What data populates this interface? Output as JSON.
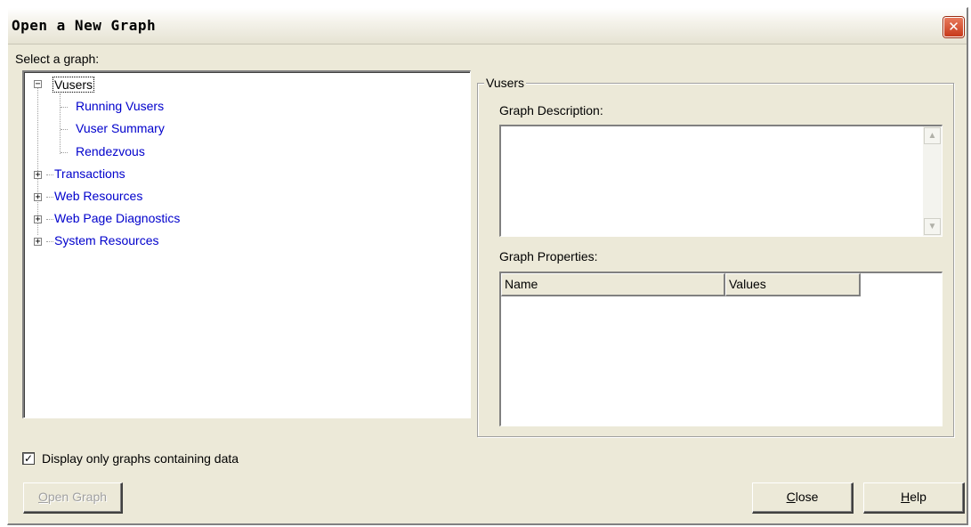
{
  "dialog": {
    "title": "Open a New Graph",
    "close_glyph": "✕"
  },
  "tree": {
    "label": "Select a graph:",
    "root": {
      "label": "Vusers",
      "expander": "−",
      "children": [
        "Running Vusers",
        "Vuser Summary",
        "Rendezvous"
      ]
    },
    "collapsed": [
      {
        "label": "Transactions",
        "expander": "+"
      },
      {
        "label": "Web Resources",
        "expander": "+"
      },
      {
        "label": "Web Page Diagnostics",
        "expander": "+"
      },
      {
        "label": "System Resources",
        "expander": "+"
      }
    ]
  },
  "details": {
    "group_title": "Vusers",
    "description_label": "Graph Description:",
    "description_value": "",
    "properties_label": "Graph Properties:",
    "columns": [
      "Name",
      "Values"
    ]
  },
  "options": {
    "display_only_data_label": "Display only graphs containing data",
    "display_only_data_checked": true,
    "check_glyph": "✓"
  },
  "buttons": {
    "open_graph_pre": "",
    "open_graph_mn": "O",
    "open_graph_post": "pen Graph",
    "close_mn": "C",
    "close_post": "lose",
    "help_mn": "H",
    "help_post": "elp"
  },
  "icons": {
    "scroll_up": "▲",
    "scroll_down": "▼"
  },
  "colors": {
    "dialog_bg": "#ece9d8",
    "tree_link": "#0000cc",
    "close_button": "#c7391b"
  }
}
